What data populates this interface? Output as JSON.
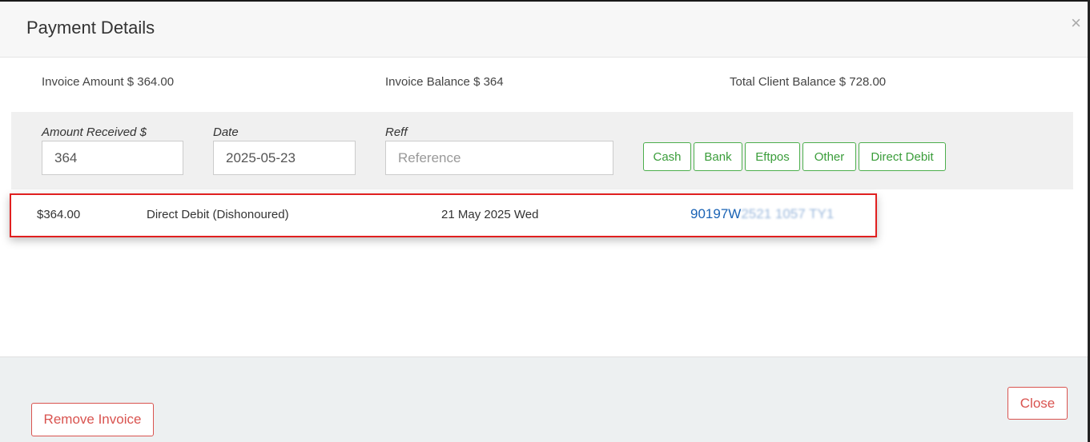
{
  "modal": {
    "title": "Payment Details",
    "close_glyph": "×"
  },
  "summary": {
    "invoice_amount": "Invoice Amount $ 364.00",
    "invoice_balance": "Invoice Balance $ 364",
    "total_client_balance": "Total Client Balance $ 728.00"
  },
  "form": {
    "amount_label": "Amount Received $",
    "amount_value": "364",
    "date_label": "Date",
    "date_value": "2025-05-23",
    "reff_label": "Reff",
    "reff_placeholder": "Reference"
  },
  "payment_methods": [
    "Cash",
    "Bank",
    "Eftpos",
    "Other",
    "Direct Debit"
  ],
  "payments": [
    {
      "amount": "$364.00",
      "method": "Direct Debit (Dishonoured)",
      "date": "21 May 2025 Wed",
      "reference_visible": "90197W",
      "reference_obscured": "2521 1057 TY1"
    }
  ],
  "footer": {
    "remove_label": "Remove Invoice",
    "close_label": "Close"
  },
  "colors": {
    "accent_green": "#3a9d3a",
    "danger_red": "#d9534f",
    "highlight_red": "#e02020",
    "link_blue": "#1a63b5"
  }
}
